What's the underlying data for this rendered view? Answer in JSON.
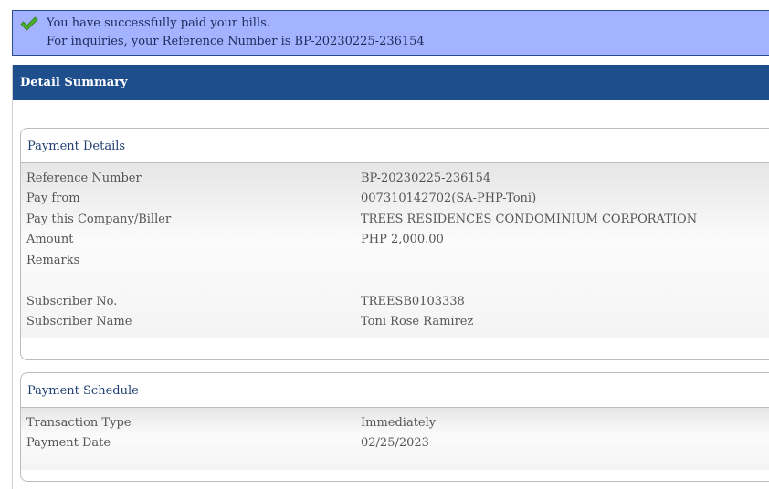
{
  "banner": {
    "icon": "checkmark-icon",
    "success_message": "You have successfully paid your bills.",
    "reference_message": "For inquiries, your Reference Number is BP-20230225-236154",
    "background_color": "#a3b3ff"
  },
  "summary": {
    "title": "Detail Summary",
    "header_color": "#1f4e8c"
  },
  "payment_details": {
    "title": "Payment Details",
    "rows": [
      {
        "label": "Reference Number",
        "value": "BP-20230225-236154"
      },
      {
        "label": "Pay from",
        "value": "007310142702(SA-PHP-Toni)"
      },
      {
        "label": "Pay this Company/Biller",
        "value": "TREES RESIDENCES CONDOMINIUM CORPORATION"
      },
      {
        "label": "Amount",
        "value": "PHP 2,000.00"
      },
      {
        "label": "Remarks",
        "value": ""
      },
      {
        "label": "Subscriber No.",
        "value": "TREESB0103338"
      },
      {
        "label": "Subscriber Name",
        "value": "Toni Rose Ramirez"
      }
    ]
  },
  "payment_schedule": {
    "title": "Payment Schedule",
    "rows": [
      {
        "label": "Transaction Type",
        "value": "Immediately"
      },
      {
        "label": "Payment Date",
        "value": "02/25/2023"
      }
    ]
  }
}
